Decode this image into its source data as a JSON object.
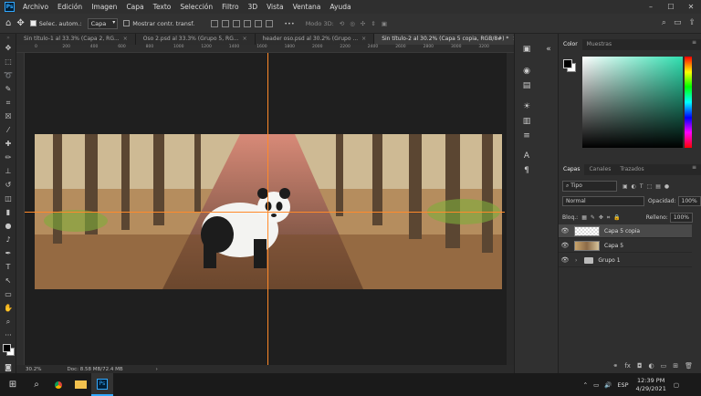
{
  "app": {
    "logo": "Ps"
  },
  "menu": [
    "Archivo",
    "Edición",
    "Imagen",
    "Capa",
    "Texto",
    "Selección",
    "Filtro",
    "3D",
    "Vista",
    "Ventana",
    "Ayuda"
  ],
  "window_controls": [
    "–",
    "☐",
    "✕"
  ],
  "options": {
    "auto_select_label": "Selec. autom.:",
    "auto_select_value": "Capa",
    "transform_label": "Mostrar contr. transf.",
    "mode3d_label": "Modo 3D:",
    "more": "•••"
  },
  "tabs": [
    {
      "label": "Sin título-1 al 33.3% (Capa 2, RG...",
      "close": "×"
    },
    {
      "label": "Oso 2.psd al 33.3% (Grupo 5, RG...",
      "close": "×"
    },
    {
      "label": "header oso.psd al 30.2% (Grupo ...",
      "close": "×"
    },
    {
      "label": "Sin título-2 al 30.2% (Capa 5 copia, RGB/8#) *",
      "close": "×"
    }
  ],
  "ruler_ticks": [
    "0",
    "200",
    "400",
    "600",
    "800",
    "1000",
    "1200",
    "1400",
    "1600",
    "1800",
    "2000",
    "2200",
    "2400",
    "2600",
    "2800",
    "3000",
    "3200"
  ],
  "status": {
    "zoom": "30.2%",
    "doc": "Doc: 8.58 MB/72.4 MB",
    "arrow": "›"
  },
  "color_panel": {
    "tabs": [
      "Color",
      "Muestras"
    ]
  },
  "layers_panel": {
    "tabs": [
      "Capas",
      "Canales",
      "Trazados"
    ],
    "filter": "Tipo",
    "blend_mode": "Normal",
    "opacity_label": "Opacidad:",
    "opacity_value": "100%",
    "lock_label": "Bloq.:",
    "fill_label": "Relleno:",
    "fill_value": "100%",
    "layers": [
      {
        "name": "Capa 5 copia",
        "selected": true
      },
      {
        "name": "Capa 5",
        "selected": false
      },
      {
        "name": "Grupo 1",
        "selected": false
      }
    ]
  },
  "taskbar": {
    "lang": "ESP",
    "time": "12:39 PM",
    "date": "4/29/2021"
  },
  "colors": {
    "accent": "#31a8ff",
    "guide": "#ff8a2a"
  }
}
